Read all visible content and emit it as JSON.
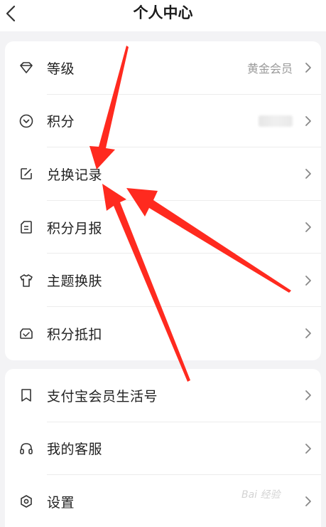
{
  "header": {
    "title": "个人中心"
  },
  "menu_group_1": [
    {
      "label": "等级",
      "value": "黄金会员",
      "icon": "diamond-icon"
    },
    {
      "label": "积分",
      "value": "",
      "icon": "points-coin-icon"
    },
    {
      "label": "兑换记录",
      "value": "",
      "icon": "edit-record-icon"
    },
    {
      "label": "积分月报",
      "value": "",
      "icon": "report-doc-icon"
    },
    {
      "label": "主题换肤",
      "value": "",
      "icon": "tshirt-icon"
    },
    {
      "label": "积分抵扣",
      "value": "",
      "icon": "ticket-icon"
    }
  ],
  "menu_group_2": [
    {
      "label": "支付宝会员生活号",
      "icon": "bookmark-icon"
    },
    {
      "label": "我的客服",
      "icon": "headset-icon"
    },
    {
      "label": "设置",
      "icon": "settings-hex-icon"
    }
  ],
  "watermark": "Bai 经验",
  "colors": {
    "annotation_arrow": "#ff2a1f",
    "chevron": "#888888"
  }
}
